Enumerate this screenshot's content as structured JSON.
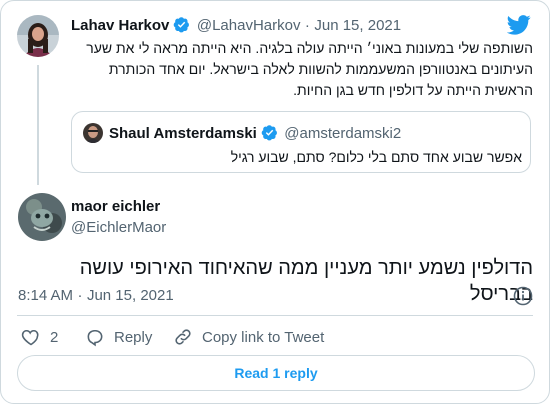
{
  "parent_tweet": {
    "author_name": "Lahav Harkov",
    "handle": "@LahavHarkov",
    "separator": "·",
    "date": "Jun 15, 2021",
    "text": "השותפה שלי במעונות באוני׳ הייתה עולה בלגיה. היא הייתה מראה לי את שער העיתונים באנטוורפן המשעממות להשוות לאלה בישראל. יום אחד הכותרת הראשית הייתה על דולפין חדש בגן החיות."
  },
  "quoted_tweet": {
    "author_name": "Shaul Amsterdamski",
    "handle": "@amsterdamski2",
    "text": "אפשר שבוע אחד סתם בלי כלום? סתם, שבוע רגיל"
  },
  "reply_tweet": {
    "author_name": "maor eichler",
    "handle": "@EichlerMaor",
    "text": "הדולפין נשמע יותר מעניין ממה שהאיחוד האירופי עושה בבריסל",
    "time": "8:14 AM",
    "separator": "·",
    "date": "Jun 15, 2021"
  },
  "actions": {
    "like_count": "2",
    "reply_label": "Reply",
    "copy_link_label": "Copy link to Tweet"
  },
  "read_replies_label": "Read 1 reply",
  "colors": {
    "accent": "#1d9bf0",
    "muted_text": "#536471",
    "border": "#cfd9de"
  }
}
